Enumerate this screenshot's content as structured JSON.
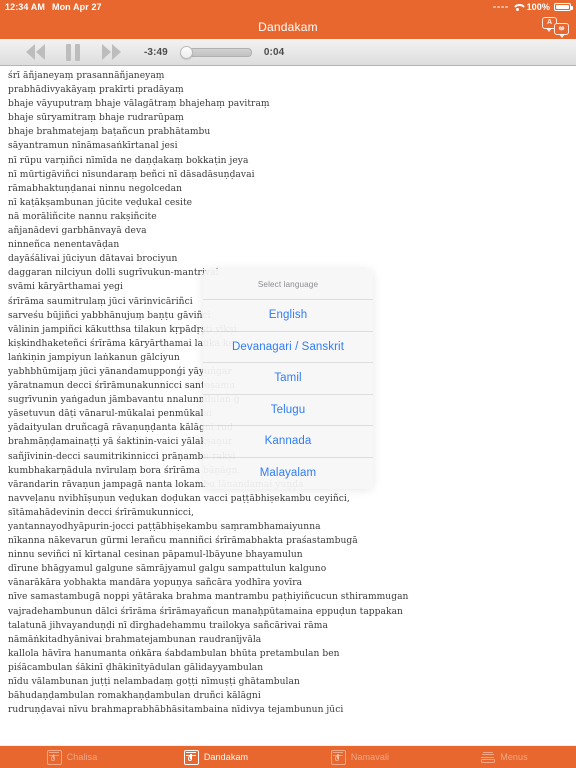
{
  "status_bar": {
    "time": "12:34 AM",
    "date": "Mon Apr 27",
    "battery_percent": "100%",
    "wifi_icon": "wifi-icon",
    "battery_icon": "battery-full-icon",
    "signal_icon": "signal-dots-icon"
  },
  "navbar": {
    "title": "Dandakam",
    "translate_icon": "translate-icon",
    "bubble_a_glyph": "A",
    "bubble_b_glyph": "అ",
    "bg_color": "#e8672e"
  },
  "player": {
    "rewind_icon": "rewind-icon",
    "pause_icon": "pause-icon",
    "forward_icon": "fast-forward-icon",
    "time_remaining": "-3:49",
    "time_elapsed": "0:04",
    "slider_name": "playback-scrubber",
    "progress_percent": 1.7
  },
  "lyrics": {
    "lines": [
      "śrī āñjaneyaṃ prasannāñjaneyaṃ",
      "prabhādivyakāyaṃ prakīrti pradāyaṃ",
      "bhaje vāyuputraṃ bhaje vālagātraṃ bhajehaṃ pavitraṃ",
      "bhaje sūryamitraṃ bhaje rudrarūpaṃ",
      "bhaje brahmatejaṃ baṭañcun prabhātambu",
      "sāyantramun nīnāmasaṅkīrtanal jesi",
      "nī rūpu varṇiñci nīmīda ne daṇḍakaṃ bokkaṭin jeya",
      "nī mūrtigāviñci nīsundaraṃ beñci nī dāsadāsuṇḍavai",
      "rāmabhaktuṇḍanai ninnu negolcedan",
      "nī kaṭākṣambunan jūcite veḍukal cesite",
      "nā morāliñcite nannu rakṣiñcite",
      "añjanādevi garbhānvayā deva",
      "ninneñca nenentavāḍan",
      "dayāśālivai jūciyun dātavai brociyun",
      "daggaran nilciyun dolli sugrīvukun-mantrivai",
      "svāmi kāryārthamai yegi",
      "śrīrāma saumitrulaṃ jūci vārinvicāriñci",
      "sarveśu būjiñci yabbhānujuṃ baṇṭu gāviñci",
      "vālinin jampiñci kākutthsa tilakun kṛpādṛṣṭi vīkṣi",
      "kiṣkindhaketeñci śrīrāma kāryārthamai laṅka ke",
      "laṅkiṇin jampiyun laṅkanun gālciyun",
      "yabhbhūmijaṃ jūci yānandamupponǵi yāyuṅgar",
      "yāratnamun decci śrīrāmunakunnicci santoṣamu",
      "sugrīvunin yaṅgadun jāmbavantu nnalunnilulan ǵ",
      "yāsetuvun dāṭi vānarul-mūkalai penmūkalai",
      "yādaityulan druñcagā rāvaṇuṇḍanta kālāgni rud",
      "brahmāṇḍamainaṭṭi yā śaktinin-vaici yālakṣaṇur",
      "sañjīvinin-decci saumitrikinnicci prāṇambu rakṣi",
      "kumbhakarṇādula nvīrulaṃ bora śrīrāma bāṇāgn.",
      "vārandarin rāvaṇun jampagā nanta lokambu lānandamai yuṇḍa",
      "navveḷanu nvibhīṣuṇun veḍukan doḍukan vacci paṭṭābhiṣekambu ceyiñci,",
      "sītāmahādevinin decci śrīrāmukunnicci,",
      "yantannayodhyāpurin-jocci paṭṭābhiṣekambu saṃrambhamaiyunna",
      "nīkanna nākevarun gūrmi lerañcu manniñci śrīrāmabhakta praśastambugā",
      "ninnu seviñci nī kīrtanal cesinan pāpamul-lbāyune bhayamulun",
      "dīrune bhāgyamul galgune sāmrājyamul galgu sampattulun kalguno",
      "vānarākāra yobhakta mandāra yopuṇya sañcāra yodhīra yovīra",
      "nīve samastambugā noppi yātāraka brahma mantrambu paṭhiyiñcucun sthirammugan",
      "vajradehambunun dālci śrīrāma śrīrāmayañcun manaḥpūtamaina eppuḍun tappakan",
      "talatunā jihvayanduṇḍi nī dīrghadehammu trailokya sañcārivai rāma",
      "nāmāṅkitadhyānivai brahmatejambunan raudranījvāla",
      "kallola hāvīra hanumanta oṅkāra śabdambulan bhūta pretambulan ben",
      "piśācambulan śākinī ḍhākinītyādulan gālidayyambulan",
      "nīdu vālambunan juṭṭi nelambadaṃ goṭṭi nīmuṣṭi ghātambulan",
      "bāhudaṇḍambulan romakhaṇḍambulan druñci kālāgni",
      "rudruṇḍavai nīvu brahmaprabhābhāsitambaina nīdivya tejambunun jūci"
    ]
  },
  "modal": {
    "title": "Select language",
    "options": [
      {
        "label": "English"
      },
      {
        "label": "Devanagari / Sanskrit"
      },
      {
        "label": "Tamil"
      },
      {
        "label": "Telugu"
      },
      {
        "label": "Kannada"
      },
      {
        "label": "Malayalam"
      }
    ],
    "accent_color": "#2f7df6"
  },
  "tabbar": {
    "items": [
      {
        "label": "Chalisa",
        "icon": "music-book-icon",
        "active": false
      },
      {
        "label": "Dandakam",
        "icon": "music-book-icon",
        "active": true
      },
      {
        "label": "Namavali",
        "icon": "music-book-icon",
        "active": false
      },
      {
        "label": "Menus",
        "icon": "menu-list-icon",
        "active": false
      }
    ],
    "bg_color": "#e8672e"
  }
}
